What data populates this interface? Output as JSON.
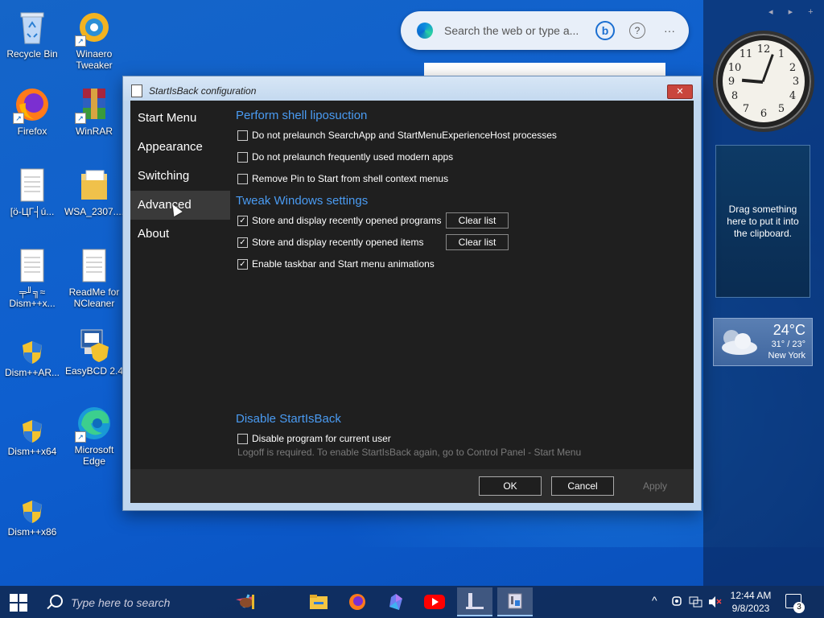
{
  "desktop": {
    "icons": [
      {
        "label": "Recycle Bin"
      },
      {
        "label": "Winaero Tweaker"
      },
      {
        "label": "Firefox"
      },
      {
        "label": "WinRAR"
      },
      {
        "label": "[ö-ЦГ┤ú..."
      },
      {
        "label": "WSA_2307...."
      },
      {
        "label": "╤╜╗≈ Dism++x..."
      },
      {
        "label": "ReadMe for NCleaner"
      },
      {
        "label": "Dism++AR..."
      },
      {
        "label": "EasyBCD 2.4"
      },
      {
        "label": "Dism++x64"
      },
      {
        "label": "Microsoft Edge"
      },
      {
        "label": "Dism++x86"
      }
    ]
  },
  "searchbar": {
    "placeholder": "Search the web or type a...",
    "bing_label": "b",
    "help_label": "?",
    "more_label": "···"
  },
  "gadgets": {
    "sidebar_controls": "◂ ▸ +",
    "clock_numbers": [
      "12",
      "1",
      "2",
      "3",
      "4",
      "5",
      "6",
      "7",
      "8",
      "9",
      "10",
      "11"
    ],
    "clipboard_text": "Drag something here to put it into the clipboard.",
    "weather": {
      "temp": "24°C",
      "range": "31° / 23°",
      "city": "New York"
    }
  },
  "dialog": {
    "title": "StartIsBack configuration",
    "close_label": "✕",
    "nav": [
      {
        "label": "Start Menu"
      },
      {
        "label": "Appearance"
      },
      {
        "label": "Switching"
      },
      {
        "label": "Advanced"
      },
      {
        "label": "About"
      }
    ],
    "sections": {
      "liposuction": {
        "heading": "Perform shell liposuction",
        "options": [
          {
            "label": "Do not prelaunch SearchApp and StartMenuExperienceHost processes",
            "checked": false
          },
          {
            "label": "Do not prelaunch frequently used modern apps",
            "checked": false
          },
          {
            "label": "Remove Pin to Start from shell context menus",
            "checked": false
          }
        ]
      },
      "tweak": {
        "heading": "Tweak Windows settings",
        "options": [
          {
            "label": "Store and display recently opened programs",
            "checked": true
          },
          {
            "label": "Store and display recently opened items",
            "checked": true
          },
          {
            "label": "Enable taskbar and Start menu animations",
            "checked": true
          }
        ],
        "clear_label": "Clear list"
      },
      "disable": {
        "heading": "Disable StartIsBack",
        "option": {
          "label": "Disable program for current user",
          "checked": false
        },
        "note": "Logoff is required. To enable StartIsBack again, go to Control Panel - Start Menu"
      }
    },
    "buttons": {
      "ok": "OK",
      "cancel": "Cancel",
      "apply": "Apply"
    }
  },
  "taskbar": {
    "search_placeholder": "Type here to search",
    "clock_time": "12:44 AM",
    "clock_date": "9/8/2023",
    "notification_count": "3",
    "tray_chevron": "^"
  }
}
